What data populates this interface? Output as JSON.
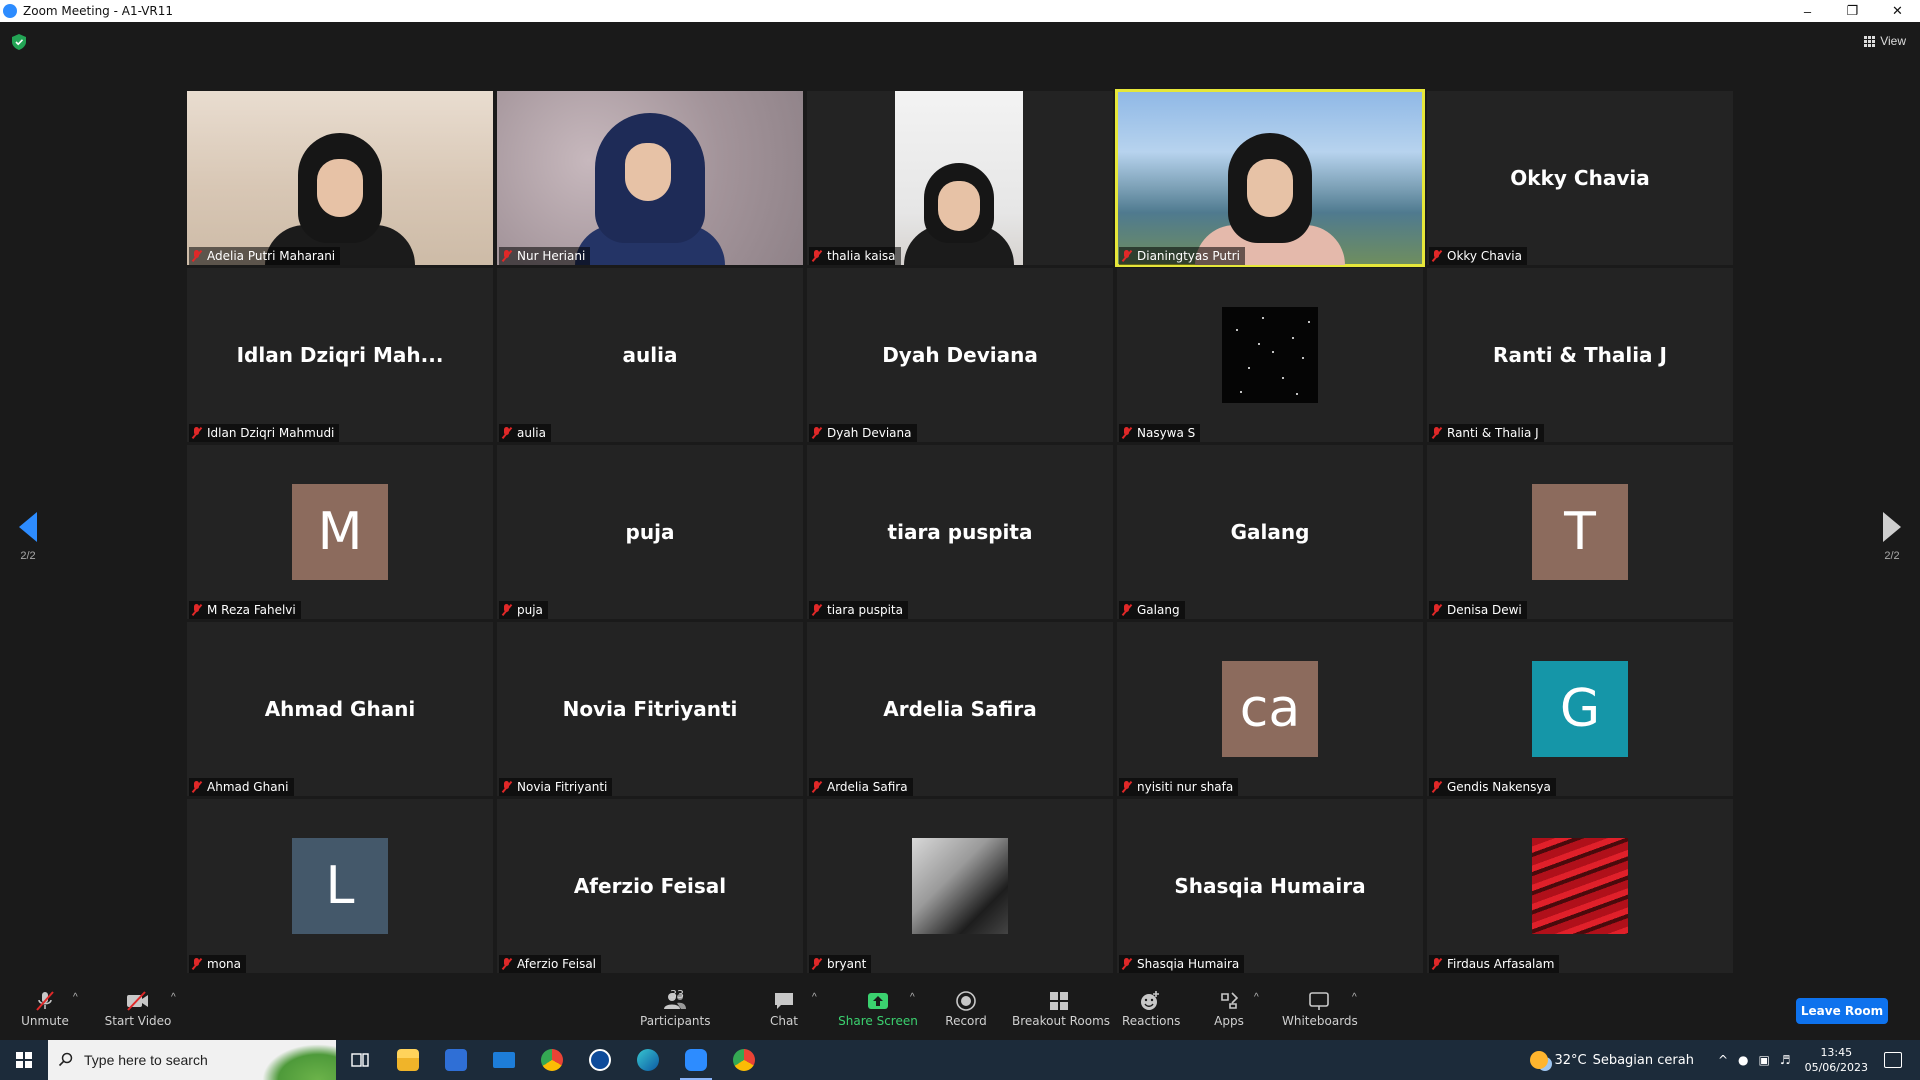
{
  "window": {
    "title": "Zoom Meeting - A1-VR11",
    "minimize": "–",
    "restore": "❐",
    "close": "✕"
  },
  "top": {
    "view_label": "View"
  },
  "pagination": {
    "left": "2/2",
    "right": "2/2"
  },
  "tiles": [
    {
      "label": "Adelia Putri Maharani",
      "kind": "video",
      "video": "room"
    },
    {
      "label": "Nur Heriani",
      "kind": "video",
      "video": "blur"
    },
    {
      "label": "thalia kaisa",
      "kind": "video",
      "video": "narrow"
    },
    {
      "label": "Dianingtyas Putri",
      "kind": "video",
      "video": "beach",
      "active": true
    },
    {
      "label": "Okky Chavia",
      "kind": "name",
      "display": "Okky Chavia"
    },
    {
      "label": "Idlan Dziqri Mahmudi",
      "kind": "name",
      "display": "Idlan Dziqri Mah..."
    },
    {
      "label": "aulia",
      "kind": "name",
      "display": "aulia"
    },
    {
      "label": "Dyah Deviana",
      "kind": "name",
      "display": "Dyah Deviana"
    },
    {
      "label": "Nasywa S",
      "kind": "starry"
    },
    {
      "label": "Ranti & Thalia J",
      "kind": "name",
      "display": "Ranti & Thalia J"
    },
    {
      "label": "M Reza Fahelvi",
      "kind": "avatar",
      "letter": "M",
      "color": "#8c6b5d"
    },
    {
      "label": "puja",
      "kind": "name",
      "display": "puja"
    },
    {
      "label": "tiara puspita",
      "kind": "name",
      "display": "tiara puspita"
    },
    {
      "label": "Galang",
      "kind": "name",
      "display": "Galang"
    },
    {
      "label": "Denisa Dewi",
      "kind": "avatar",
      "letter": "T",
      "color": "#8c6b5d"
    },
    {
      "label": "Ahmad Ghani",
      "kind": "name",
      "display": "Ahmad Ghani"
    },
    {
      "label": "Novia Fitriyanti",
      "kind": "name",
      "display": "Novia Fitriyanti"
    },
    {
      "label": "Ardelia Safira",
      "kind": "name",
      "display": "Ardelia Safira"
    },
    {
      "label": "nyisiti nur shafa",
      "kind": "avatar",
      "letter": "ca",
      "color": "#8c6b5d"
    },
    {
      "label": "Gendis Nakensya",
      "kind": "avatar",
      "letter": "G",
      "color": "#1596a8"
    },
    {
      "label": "mona",
      "kind": "avatar",
      "letter": "L",
      "color": "#44586a"
    },
    {
      "label": "Aferzio Feisal",
      "kind": "name",
      "display": "Aferzio Feisal"
    },
    {
      "label": "bryant",
      "kind": "photo-bw"
    },
    {
      "label": "Shasqia Humaira",
      "kind": "name",
      "display": "Shasqia Humaira"
    },
    {
      "label": "Firdaus Arfasalam",
      "kind": "photo-red"
    }
  ],
  "toolbar": {
    "unmute": "Unmute",
    "start_video": "Start Video",
    "participants": "Participants",
    "participants_count": "33",
    "chat": "Chat",
    "share_screen": "Share Screen",
    "record": "Record",
    "breakout_rooms": "Breakout Rooms",
    "reactions": "Reactions",
    "apps": "Apps",
    "whiteboards": "Whiteboards",
    "leave": "Leave Room"
  },
  "taskbar": {
    "search_placeholder": "Type here to search",
    "weather_temp": "32°C",
    "weather_desc": "Sebagian cerah",
    "time": "13:45",
    "date": "05/06/2023"
  },
  "colors": {
    "accent": "#2d8cff",
    "leave": "#0e72ed",
    "active_border": "#e6e73a",
    "share_green": "#3bd16f",
    "mute_red": "#e02828"
  }
}
